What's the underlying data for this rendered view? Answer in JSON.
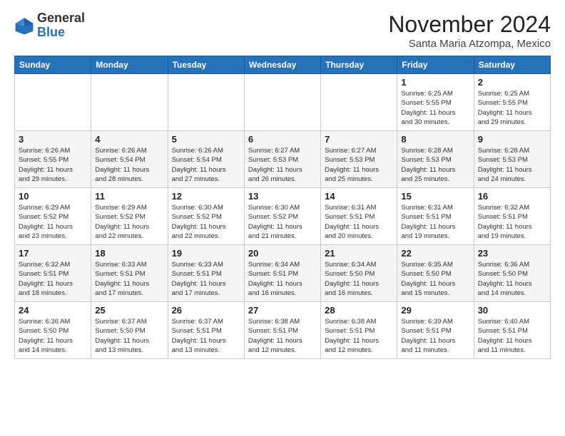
{
  "header": {
    "logo": {
      "general": "General",
      "blue": "Blue"
    },
    "title": "November 2024",
    "location": "Santa Maria Atzompa, Mexico"
  },
  "weekdays": [
    "Sunday",
    "Monday",
    "Tuesday",
    "Wednesday",
    "Thursday",
    "Friday",
    "Saturday"
  ],
  "weeks": [
    [
      {
        "day": "",
        "info": ""
      },
      {
        "day": "",
        "info": ""
      },
      {
        "day": "",
        "info": ""
      },
      {
        "day": "",
        "info": ""
      },
      {
        "day": "",
        "info": ""
      },
      {
        "day": "1",
        "info": "Sunrise: 6:25 AM\nSunset: 5:55 PM\nDaylight: 11 hours\nand 30 minutes."
      },
      {
        "day": "2",
        "info": "Sunrise: 6:25 AM\nSunset: 5:55 PM\nDaylight: 11 hours\nand 29 minutes."
      }
    ],
    [
      {
        "day": "3",
        "info": "Sunrise: 6:26 AM\nSunset: 5:55 PM\nDaylight: 11 hours\nand 29 minutes."
      },
      {
        "day": "4",
        "info": "Sunrise: 6:26 AM\nSunset: 5:54 PM\nDaylight: 11 hours\nand 28 minutes."
      },
      {
        "day": "5",
        "info": "Sunrise: 6:26 AM\nSunset: 5:54 PM\nDaylight: 11 hours\nand 27 minutes."
      },
      {
        "day": "6",
        "info": "Sunrise: 6:27 AM\nSunset: 5:53 PM\nDaylight: 11 hours\nand 26 minutes."
      },
      {
        "day": "7",
        "info": "Sunrise: 6:27 AM\nSunset: 5:53 PM\nDaylight: 11 hours\nand 25 minutes."
      },
      {
        "day": "8",
        "info": "Sunrise: 6:28 AM\nSunset: 5:53 PM\nDaylight: 11 hours\nand 25 minutes."
      },
      {
        "day": "9",
        "info": "Sunrise: 6:28 AM\nSunset: 5:53 PM\nDaylight: 11 hours\nand 24 minutes."
      }
    ],
    [
      {
        "day": "10",
        "info": "Sunrise: 6:29 AM\nSunset: 5:52 PM\nDaylight: 11 hours\nand 23 minutes."
      },
      {
        "day": "11",
        "info": "Sunrise: 6:29 AM\nSunset: 5:52 PM\nDaylight: 11 hours\nand 22 minutes."
      },
      {
        "day": "12",
        "info": "Sunrise: 6:30 AM\nSunset: 5:52 PM\nDaylight: 11 hours\nand 22 minutes."
      },
      {
        "day": "13",
        "info": "Sunrise: 6:30 AM\nSunset: 5:52 PM\nDaylight: 11 hours\nand 21 minutes."
      },
      {
        "day": "14",
        "info": "Sunrise: 6:31 AM\nSunset: 5:51 PM\nDaylight: 11 hours\nand 20 minutes."
      },
      {
        "day": "15",
        "info": "Sunrise: 6:31 AM\nSunset: 5:51 PM\nDaylight: 11 hours\nand 19 minutes."
      },
      {
        "day": "16",
        "info": "Sunrise: 6:32 AM\nSunset: 5:51 PM\nDaylight: 11 hours\nand 19 minutes."
      }
    ],
    [
      {
        "day": "17",
        "info": "Sunrise: 6:32 AM\nSunset: 5:51 PM\nDaylight: 11 hours\nand 18 minutes."
      },
      {
        "day": "18",
        "info": "Sunrise: 6:33 AM\nSunset: 5:51 PM\nDaylight: 11 hours\nand 17 minutes."
      },
      {
        "day": "19",
        "info": "Sunrise: 6:33 AM\nSunset: 5:51 PM\nDaylight: 11 hours\nand 17 minutes."
      },
      {
        "day": "20",
        "info": "Sunrise: 6:34 AM\nSunset: 5:51 PM\nDaylight: 11 hours\nand 16 minutes."
      },
      {
        "day": "21",
        "info": "Sunrise: 6:34 AM\nSunset: 5:50 PM\nDaylight: 11 hours\nand 16 minutes."
      },
      {
        "day": "22",
        "info": "Sunrise: 6:35 AM\nSunset: 5:50 PM\nDaylight: 11 hours\nand 15 minutes."
      },
      {
        "day": "23",
        "info": "Sunrise: 6:36 AM\nSunset: 5:50 PM\nDaylight: 11 hours\nand 14 minutes."
      }
    ],
    [
      {
        "day": "24",
        "info": "Sunrise: 6:36 AM\nSunset: 5:50 PM\nDaylight: 11 hours\nand 14 minutes."
      },
      {
        "day": "25",
        "info": "Sunrise: 6:37 AM\nSunset: 5:50 PM\nDaylight: 11 hours\nand 13 minutes."
      },
      {
        "day": "26",
        "info": "Sunrise: 6:37 AM\nSunset: 5:51 PM\nDaylight: 11 hours\nand 13 minutes."
      },
      {
        "day": "27",
        "info": "Sunrise: 6:38 AM\nSunset: 5:51 PM\nDaylight: 11 hours\nand 12 minutes."
      },
      {
        "day": "28",
        "info": "Sunrise: 6:38 AM\nSunset: 5:51 PM\nDaylight: 11 hours\nand 12 minutes."
      },
      {
        "day": "29",
        "info": "Sunrise: 6:39 AM\nSunset: 5:51 PM\nDaylight: 11 hours\nand 11 minutes."
      },
      {
        "day": "30",
        "info": "Sunrise: 6:40 AM\nSunset: 5:51 PM\nDaylight: 11 hours\nand 11 minutes."
      }
    ]
  ]
}
